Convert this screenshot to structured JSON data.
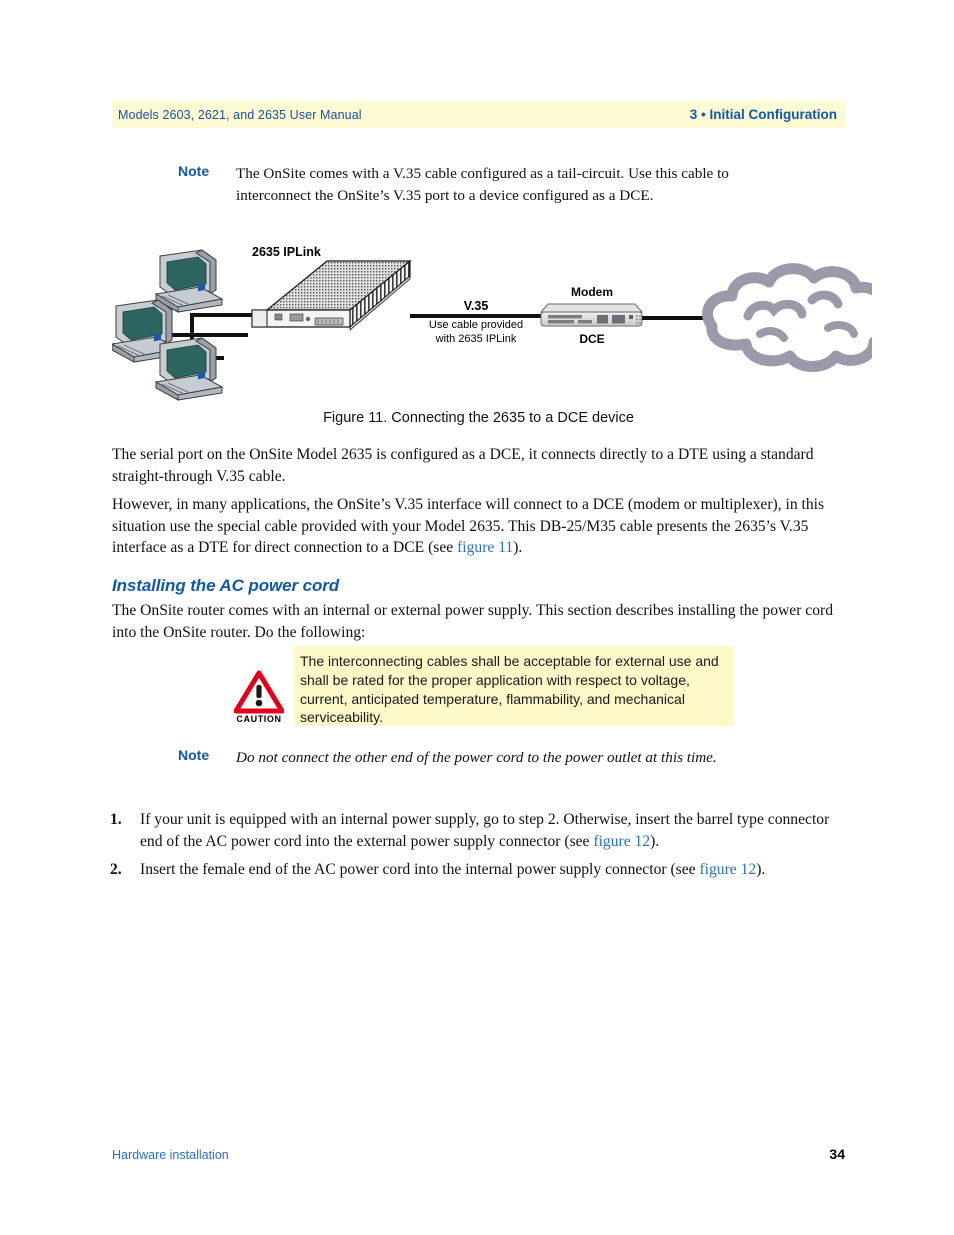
{
  "header": {
    "left": "Models 2603, 2621, and 2635 User Manual",
    "right": "3 • Initial Configuration",
    "background": "#fdfbd4",
    "accent": "#1059a8"
  },
  "note_top": {
    "label": "Note",
    "text": "The OnSite comes with a V.35 cable configured as a tail-circuit. Use this cable to interconnect the OnSite’s V.35 port to a device configured as a DCE."
  },
  "figure": {
    "caption": "Figure 11. Connecting the 2635 to a DCE device",
    "labels": {
      "device": "2635 IPLink",
      "link_title": "V.35",
      "link_line1": "Use cable provided",
      "link_line2": "with 2635 IPLink",
      "modem": "Modem",
      "modem_role": "DCE"
    },
    "colors": {
      "cloud": "#9a9aab",
      "device_body": "#e8e8e8",
      "device_outline": "#1a1a1a",
      "screen": "#2d6660",
      "cable": "#111111"
    },
    "nodes": [
      "workstation-top",
      "workstation-middle",
      "workstation-bottom",
      "2635 IPLink",
      "Modem",
      "network-cloud"
    ]
  },
  "paragraphs": {
    "p1_a": "The serial port on the OnSite Model 2635 is configured as a DCE, it connects directly to a DTE using a standard straight-through V.35 cable.",
    "p2_a": "However, in many applications, the OnSite’s V.35 interface will connect to a DCE (modem or multiplexer), in this situation use the special cable provided with your Model 2635. This DB-25/M35 cable presents the 2635’s V.35 interface as a DTE for direct connection to a DCE (see ",
    "p2_link": "figure 11",
    "p2_b": ").",
    "p3_a": "The OnSite router comes with an internal or external power supply. This section describes installing the power cord into the OnSite router. Do the following:"
  },
  "section": {
    "heading": "Installing the AC power cord"
  },
  "caution": {
    "icon_caption": "CAUTION",
    "text": "The interconnecting cables shall be acceptable for external use and shall be rated for the proper application with respect to voltage, current, anticipated temperature, flammability, and mechanical serviceability.",
    "background": "#fcf8c8",
    "icon_color": "#e2001a"
  },
  "note_power": {
    "label": "Note",
    "text": "Do not connect the other end of the power cord to the power outlet at this time."
  },
  "list": {
    "items": [
      {
        "marker": "1.",
        "text_a": "If your unit is equipped with an internal power supply, go to step 2. Otherwise, insert the barrel type connector end of the AC power cord into the external power supply connector (see ",
        "link": "figure 12",
        "text_b": ")."
      },
      {
        "marker": "2.",
        "text_a": "Insert the female end of the AC power cord into the internal power supply connector (see ",
        "link": "figure 12",
        "text_b": ")."
      }
    ]
  },
  "footer": {
    "left": "Hardware installation",
    "page_number": "34",
    "link_color": "#2a6fc4"
  }
}
